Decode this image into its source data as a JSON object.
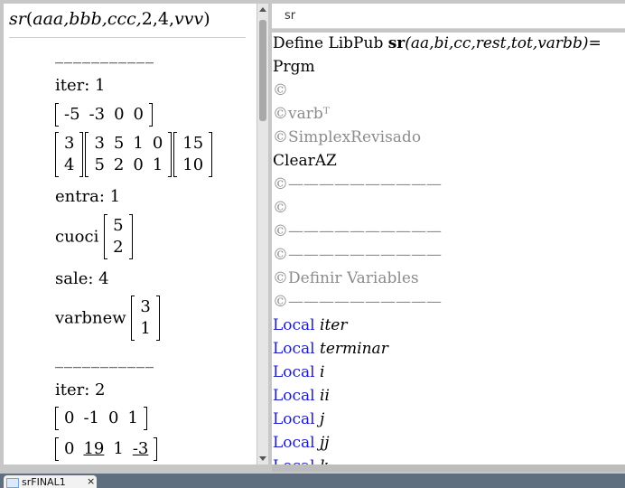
{
  "left": {
    "command": {
      "fn": "sr",
      "args": "aaa,bbb,ccc,",
      "nums": "2,4,",
      "last": "vvv"
    },
    "dashes": "___________",
    "iter1": {
      "label": "iter:  1",
      "row": [
        "-5",
        "-3",
        "0",
        "0"
      ],
      "m1": [
        [
          "3"
        ],
        [
          "4"
        ]
      ],
      "m2": [
        [
          "3",
          "5",
          "1",
          "0"
        ],
        [
          "5",
          "2",
          "0",
          "1"
        ]
      ],
      "m3": [
        [
          "15"
        ],
        [
          "10"
        ]
      ],
      "entra": "entra:  1",
      "cuoci_label": "cuoci",
      "cuoci": [
        [
          "5"
        ],
        [
          "2"
        ]
      ],
      "sale": "sale:  4",
      "varbnew_label": "varbnew",
      "varbnew": [
        [
          "3"
        ],
        [
          "1"
        ]
      ]
    },
    "iter2": {
      "label": "iter:  2",
      "row": [
        "0",
        "-1",
        "0",
        "1"
      ],
      "partial": [
        "0",
        "19",
        "1",
        "-3"
      ]
    }
  },
  "right": {
    "search": "sr",
    "lines": [
      {
        "t": "Define LibPub ",
        "b": "sr",
        "rest": "(aa,bi,cc,rest,tot,varbb)="
      },
      {
        "t": "Prgm"
      },
      {
        "c": "©"
      },
      {
        "c": "©varbᵀ"
      },
      {
        "c": "©SimplexRevisado"
      },
      {
        "t": "ClearAZ"
      },
      {
        "c": "©——————————"
      },
      {
        "c": "©"
      },
      {
        "c": "©——————————"
      },
      {
        "c": "©——————————"
      },
      {
        "c": "©Definir Variables"
      },
      {
        "c": "©——————————"
      },
      {
        "k": "Local ",
        "v": "iter"
      },
      {
        "k": "Local ",
        "v": "terminar"
      },
      {
        "k": "Local ",
        "v": "i"
      },
      {
        "k": "Local ",
        "v": "ii"
      },
      {
        "k": "Local ",
        "v": "j"
      },
      {
        "k": "Local ",
        "v": "jj"
      },
      {
        "k": "Local ",
        "v": "k"
      }
    ]
  },
  "tab": {
    "name": "srFINAL1",
    "close": "×"
  }
}
